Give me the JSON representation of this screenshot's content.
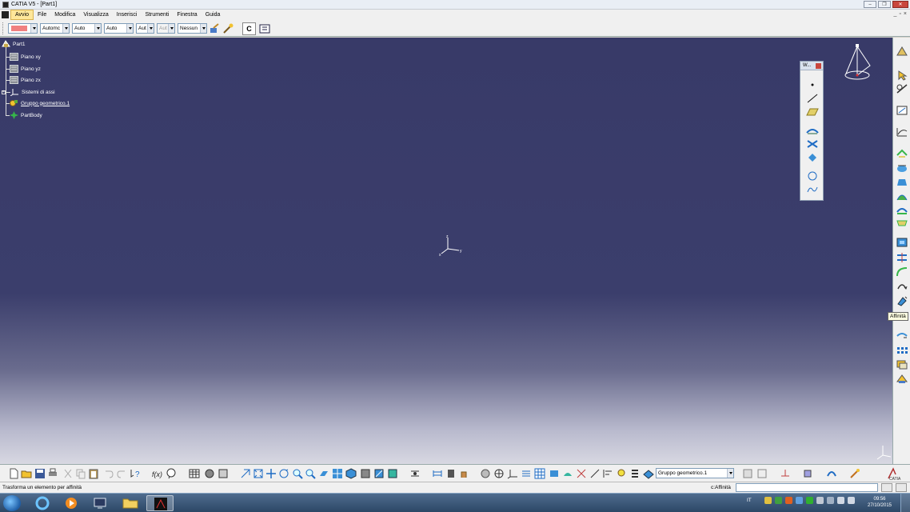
{
  "window": {
    "title": "CATIA V5 - [Part1]",
    "controls": {
      "minimize": "–",
      "restore": "❐",
      "close": "✕"
    }
  },
  "menubar": {
    "items": [
      "Avvio",
      "File",
      "Modifica",
      "Visualizza",
      "Inserisci",
      "Strumenti",
      "Finestra",
      "Guida"
    ],
    "active": "Avvio",
    "doc_controls": {
      "minimize": "_",
      "restore": "▫",
      "close": "×"
    }
  },
  "properties_toolbar": {
    "fill_color": "#f08080",
    "transparency": "Automc",
    "line_thickness": "Auto",
    "line_type": "Auto",
    "point_symbol": "Aut",
    "rendering": "Aut",
    "layer": "Nessun"
  },
  "spec_tree": {
    "root": "Part1",
    "items": [
      {
        "label": "Piano xy",
        "icon": "plane-icon",
        "underline": false
      },
      {
        "label": "Piano yz",
        "icon": "plane-icon",
        "underline": false
      },
      {
        "label": "Piano zx",
        "icon": "plane-icon",
        "underline": false
      },
      {
        "label": "Sistemi di assi",
        "icon": "axis-system-icon",
        "underline": false
      },
      {
        "label": "Gruppo geometrico.1",
        "icon": "geometrical-set-icon",
        "underline": true
      },
      {
        "label": "PartBody",
        "icon": "partbody-icon",
        "underline": false
      }
    ]
  },
  "floating_toolbar": {
    "title": "W..."
  },
  "axes": {
    "x": "x",
    "y": "y",
    "z": "z"
  },
  "tooltip": "Affinità",
  "bottom_toolbar": {
    "current_geometrical_set": "Gruppo geometrico.1"
  },
  "statusbar": {
    "message": "Trasforma un elemento per affinità",
    "command_label": "c:Affinità",
    "command_value": ""
  },
  "taskbar": {
    "language": "IT",
    "time": "09:56",
    "date": "27/10/2015"
  }
}
